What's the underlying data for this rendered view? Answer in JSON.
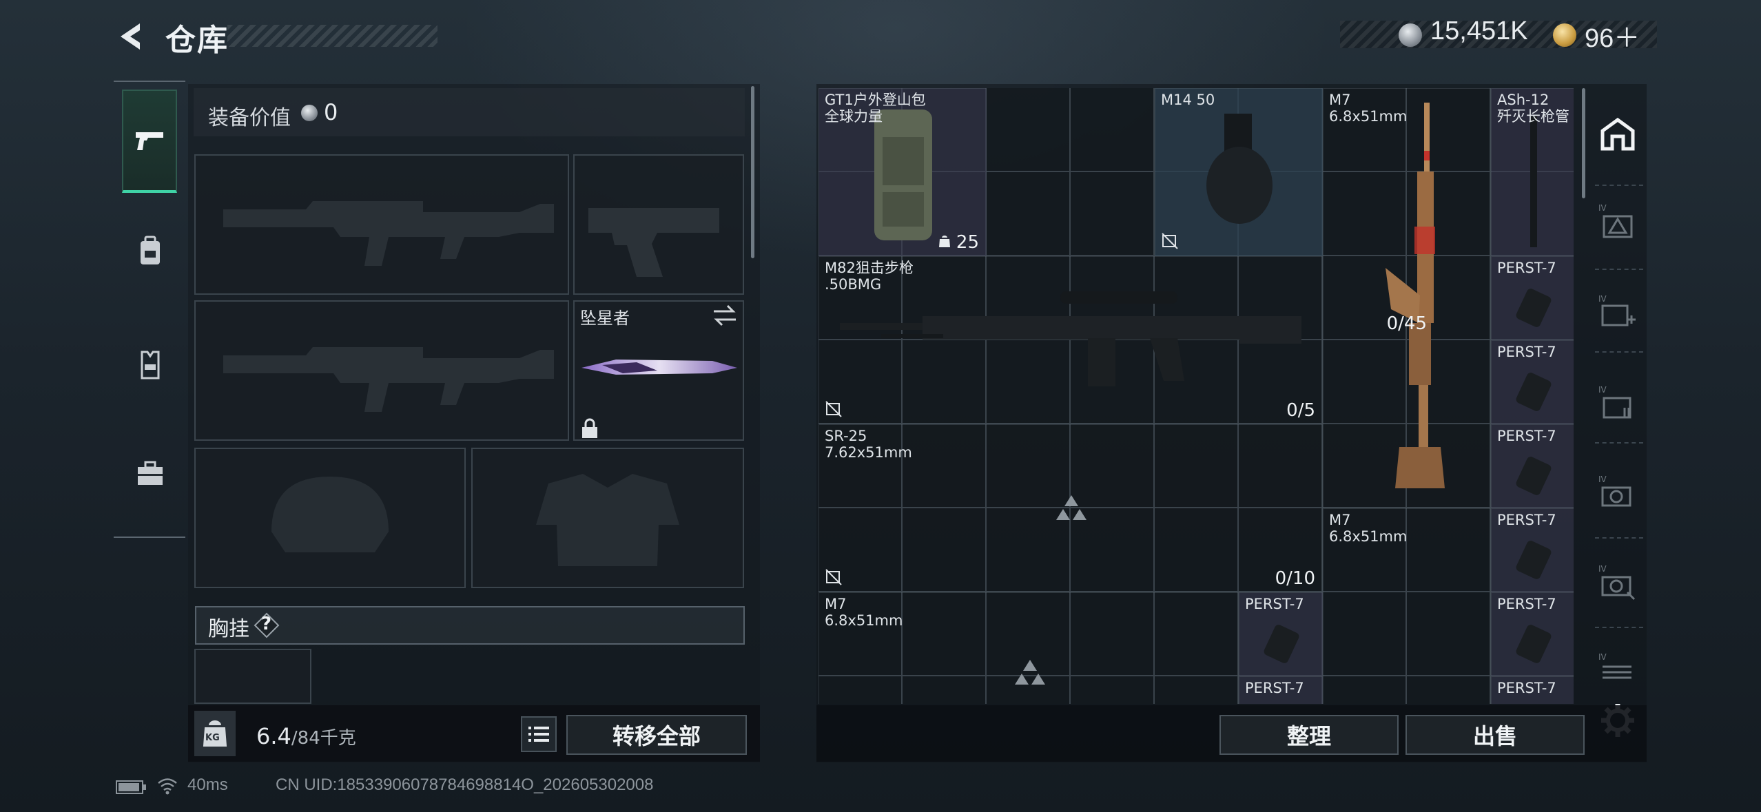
{
  "header": {
    "title": "仓库",
    "back_icon": "back-arrow-icon"
  },
  "currency": {
    "silver_amount": "15,451K",
    "gold_amount": "96＋"
  },
  "tabs": [
    {
      "icon": "pistol-icon",
      "active": true
    },
    {
      "icon": "backpack-icon",
      "active": false
    },
    {
      "icon": "vest-icon",
      "active": false
    },
    {
      "icon": "toolbox-icon",
      "active": false
    }
  ],
  "equipment": {
    "value_label": "装备价值",
    "value": "0",
    "melee_name": "坠星者",
    "chest_label": "胸挂",
    "help": "?",
    "weight_current": "6.4",
    "weight_max": "/84千克",
    "kg_label": "KG",
    "transfer_all": "转移全部"
  },
  "storage": {
    "items": [
      {
        "id": "backpack",
        "name": "GT1户外登山包",
        "sub": "全球力量",
        "count": "25"
      },
      {
        "id": "m14",
        "name": "M14 50",
        "sub": ""
      },
      {
        "id": "m7a",
        "name": "M7",
        "sub": "6.8x51mm",
        "count": "0/45"
      },
      {
        "id": "ash12",
        "name": "ASh-12",
        "sub": "歼灭长枪管"
      },
      {
        "id": "m82",
        "name": "M82狙击步枪",
        "sub": ".50BMG",
        "count": "0/5"
      },
      {
        "id": "sr25",
        "name": "SR-25",
        "sub": "7.62x51mm",
        "count": "0/10"
      },
      {
        "id": "m7b",
        "name": "M7",
        "sub": "6.8x51mm"
      },
      {
        "id": "m7c",
        "name": "M7",
        "sub": "6.8x51mm"
      }
    ],
    "perst_label": "PERST-7",
    "sort": "整理",
    "sell": "出售"
  },
  "side_icons": [
    "home-icon",
    "iv-rifle-icon",
    "iv-medkit-icon",
    "iv-ammo-icon",
    "iv-scope-icon",
    "iv-camera-icon",
    "iv-case-icon",
    "settings-icon"
  ],
  "footer": {
    "ping": "40ms",
    "uid": "CN UID:18533906078784698814O_202605302008"
  }
}
